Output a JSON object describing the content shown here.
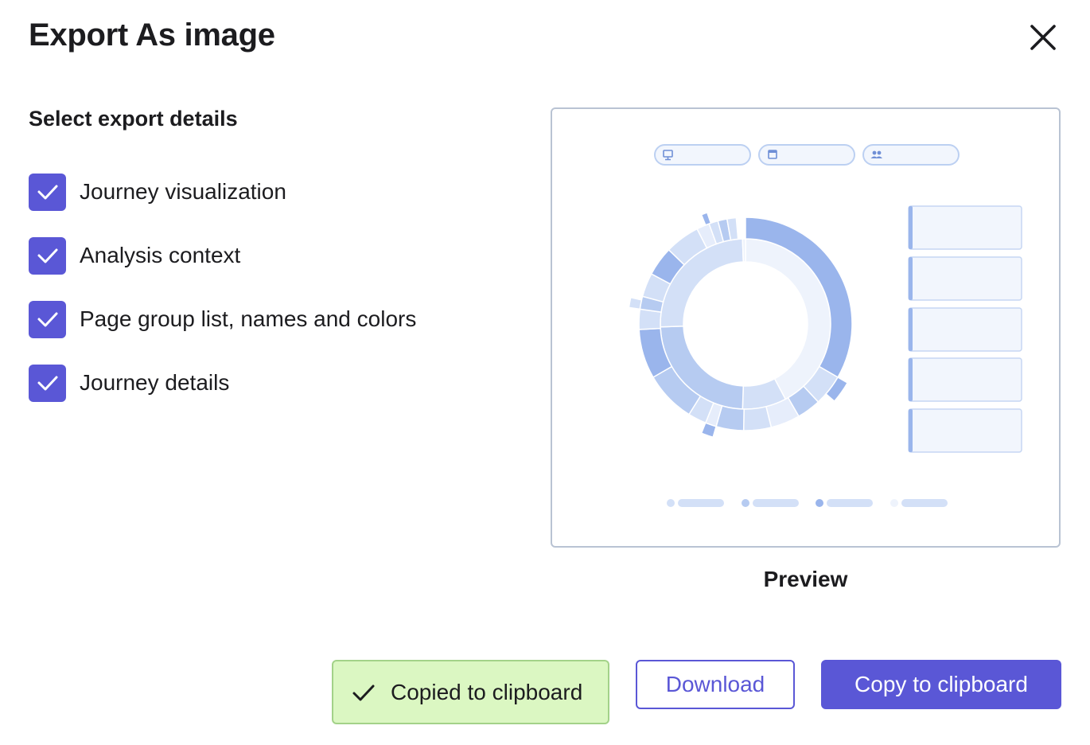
{
  "dialog": {
    "title": "Export As image",
    "close_icon": "close-icon"
  },
  "options": {
    "section_title": "Select export details",
    "items": [
      {
        "label": "Journey visualization",
        "checked": true
      },
      {
        "label": "Analysis context",
        "checked": true
      },
      {
        "label": "Page group list, names and colors",
        "checked": true
      },
      {
        "label": "Journey details",
        "checked": true
      }
    ]
  },
  "preview": {
    "label": "Preview",
    "filter_pill_icons": [
      "monitor-icon",
      "calendar-icon",
      "users-icon"
    ]
  },
  "toast": {
    "text": "Copied to clipboard",
    "icon": "check-icon"
  },
  "actions": {
    "download_label": "Download",
    "copy_label": "Copy to clipboard"
  },
  "colors": {
    "accent": "#5a57d6",
    "toast_bg": "#dbf7c2",
    "toast_border": "#a3d289",
    "preview_blue": "#9ab5ec"
  }
}
